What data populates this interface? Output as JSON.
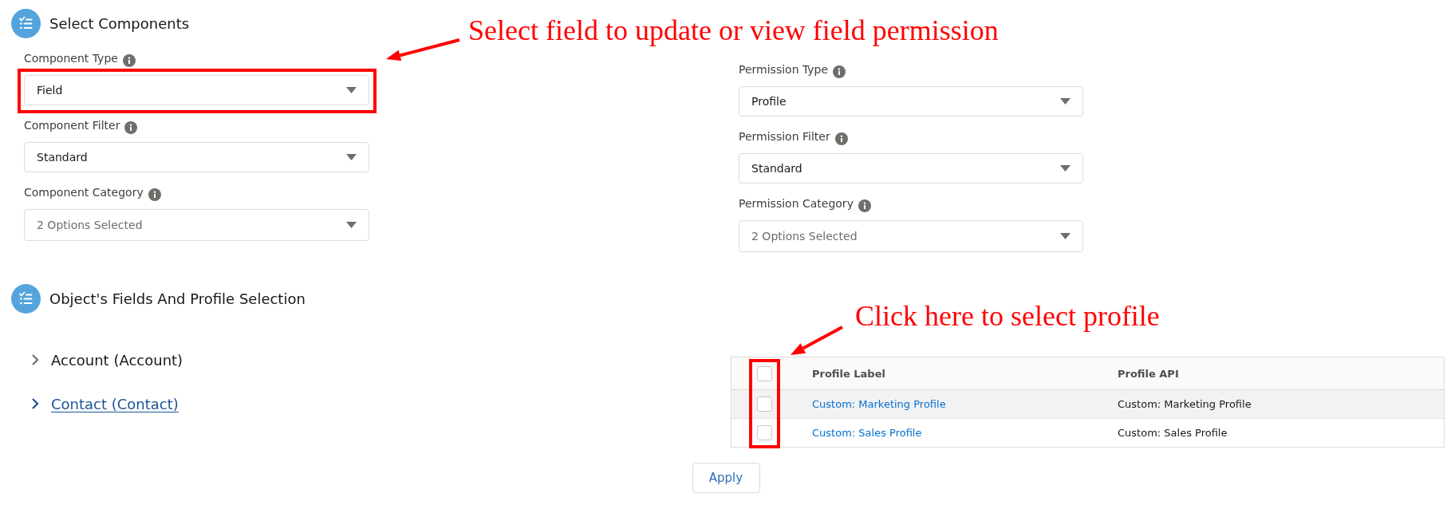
{
  "select_components": {
    "title": "Select Components",
    "component_fields": [
      {
        "label": "Component Type",
        "value": "Field",
        "highlighted": true
      },
      {
        "label": "Component Filter",
        "value": "Standard",
        "highlighted": false
      },
      {
        "label": "Component Category",
        "placeholder": "2 Options Selected",
        "highlighted": false
      }
    ],
    "permission_fields": [
      {
        "label": "Permission Type",
        "value": "Profile",
        "highlighted": false
      },
      {
        "label": "Permission Filter",
        "value": "Standard",
        "highlighted": false
      },
      {
        "label": "Permission Category",
        "placeholder": "2 Options Selected",
        "highlighted": false
      }
    ]
  },
  "fields_and_profiles": {
    "title": "Object's Fields And Profile Selection",
    "objects": [
      {
        "label": "Account (Account)",
        "expanded": false,
        "active": false
      },
      {
        "label": "Contact (Contact)",
        "expanded": false,
        "active": true
      }
    ],
    "profile_table": {
      "checkbox_column_highlighted": true,
      "select_all": {
        "checked": false
      },
      "columns": [
        "Profile Label",
        "Profile API"
      ],
      "rows": [
        {
          "checked": false,
          "hovered": true,
          "cells": [
            {
              "kind": "link",
              "text": "Custom: Marketing Profile"
            },
            {
              "kind": "text",
              "text": "Custom: Marketing Profile"
            }
          ]
        },
        {
          "checked": false,
          "hovered": false,
          "cells": [
            {
              "kind": "link",
              "text": "Custom: Sales Profile"
            },
            {
              "kind": "text",
              "text": "Custom: Sales Profile"
            }
          ]
        }
      ]
    }
  },
  "apply_button": {
    "label": "Apply"
  },
  "annotations": [
    {
      "text": "Select field to update or view field permission"
    },
    {
      "text": "Click here to select profile"
    }
  ]
}
